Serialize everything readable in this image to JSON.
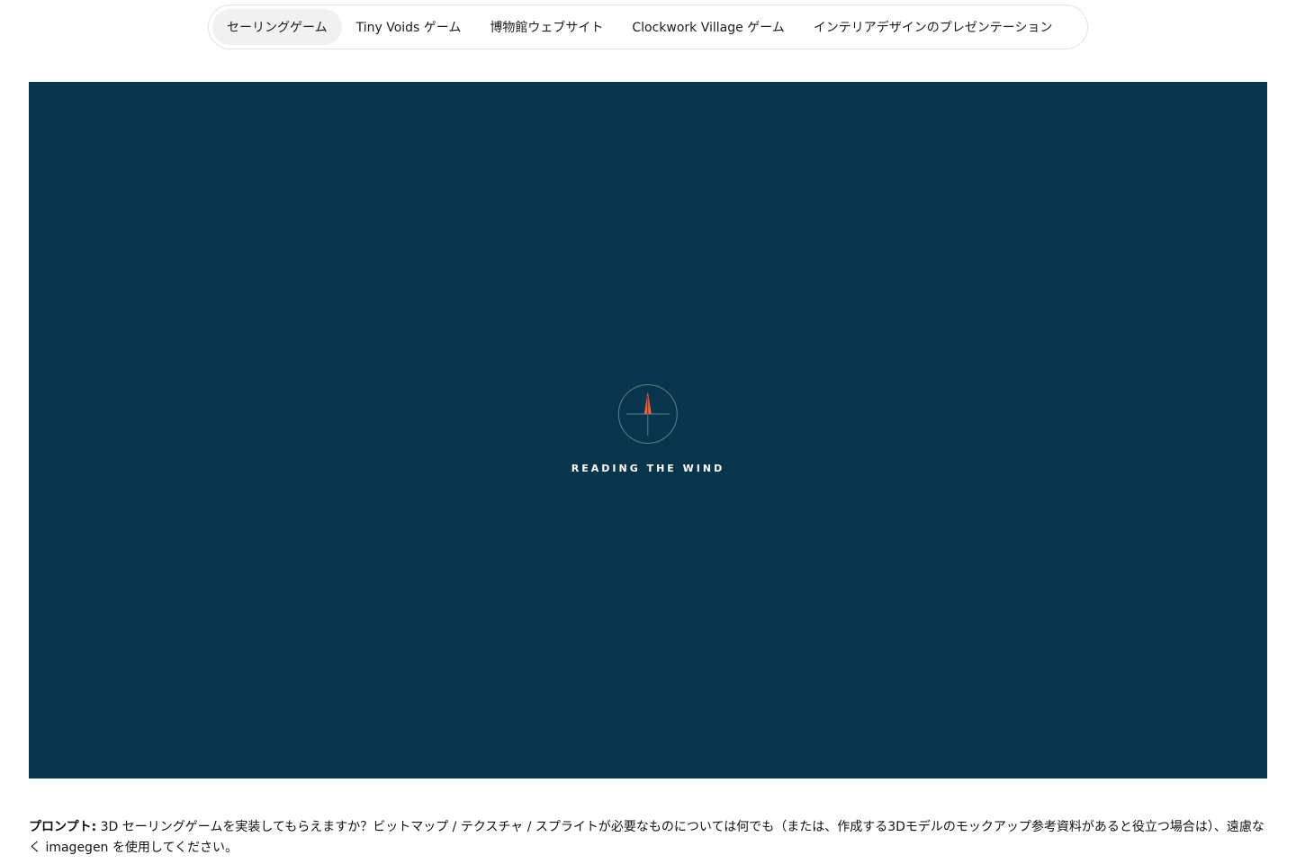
{
  "tabs": {
    "items": [
      {
        "label": "セーリングゲーム"
      },
      {
        "label": "Tiny Voids ゲーム"
      },
      {
        "label": "博物館ウェブサイト"
      },
      {
        "label": "Clockwork Village ゲーム"
      },
      {
        "label": "インテリアデザインのプレゼンテーション"
      }
    ],
    "active_index": 0
  },
  "stage": {
    "loading_text": "READING THE WIND",
    "background_color": "#08344c",
    "accent_color": "#f0623a"
  },
  "prompt": {
    "label": "プロンプト:",
    "text": " 3D セーリングゲームを実装してもらえますか？ビットマップ / テクスチャ / スプライトが必要なものについては何でも（または、作成する3Dモデルのモックアップ参考資料があると役立つ場合は）、遠慮なく imagegen を使用してください。"
  }
}
